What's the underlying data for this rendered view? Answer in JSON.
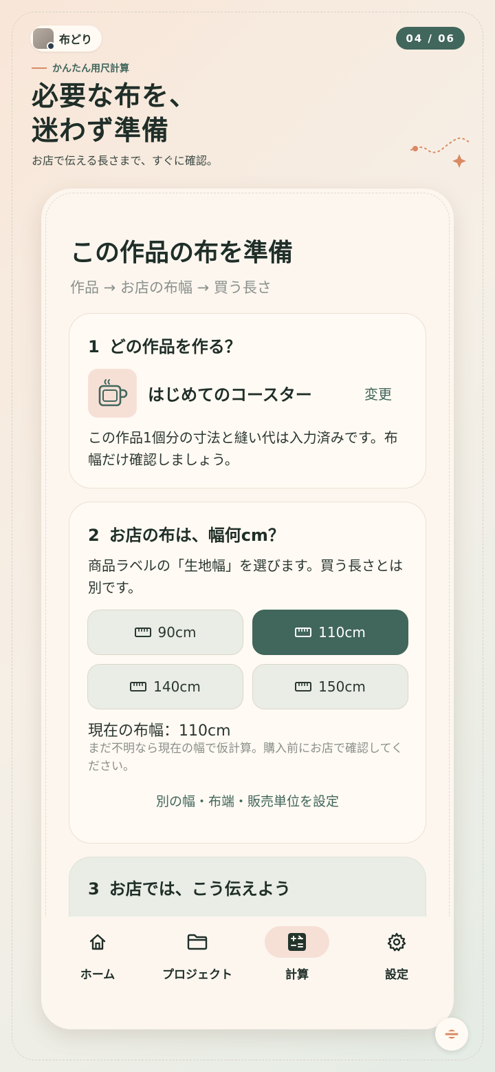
{
  "brand": {
    "name": "布どり"
  },
  "page_counter": "04 / 06",
  "intro": {
    "kicker": "かんたん用尺計算",
    "headline_line1": "必要な布を、",
    "headline_line2": "迷わず準備",
    "subhead": "お店で伝える長さまで、すぐに確認。"
  },
  "card": {
    "title": "この作品の布を準備",
    "flow": "作品 → お店の布幅 → 買う長さ"
  },
  "step1": {
    "number": "1",
    "title": "どの作品を作る？",
    "project_name": "はじめてのコースター",
    "project_icon": "mug-icon",
    "change_label": "変更",
    "description": "この作品1個分の寸法と縫い代は入力済みです。布幅だけ確認しましょう。"
  },
  "step2": {
    "number": "2",
    "title": "お店の布は、幅何cm？",
    "description": "商品ラベルの「生地幅」を選びます。買う長さとは別です。",
    "options": [
      {
        "label": "90cm",
        "selected": false
      },
      {
        "label": "110cm",
        "selected": true
      },
      {
        "label": "140cm",
        "selected": false
      },
      {
        "label": "150cm",
        "selected": false
      }
    ],
    "option_icon": "ruler-icon",
    "current_width": "現在の布幅：110cm",
    "note": "まだ不明なら現在の幅で仮計算。購入前にお店で確認してください。",
    "more_settings_link": "別の幅・布端・販売単位を設定"
  },
  "step3": {
    "number": "3",
    "title": "お店では、こう伝えよう"
  },
  "tabbar": {
    "items": [
      {
        "label": "ホーム",
        "icon": "home-icon",
        "active": false
      },
      {
        "label": "プロジェクト",
        "icon": "folder-icon",
        "active": false
      },
      {
        "label": "計算",
        "icon": "calculator-icon",
        "active": true
      },
      {
        "label": "設定",
        "icon": "gear-icon",
        "active": false
      }
    ]
  },
  "colors": {
    "accent": "#41665c",
    "accent_soft": "#f6e0d6",
    "orange": "#d98a63",
    "card_bg": "#fcf6ef"
  }
}
